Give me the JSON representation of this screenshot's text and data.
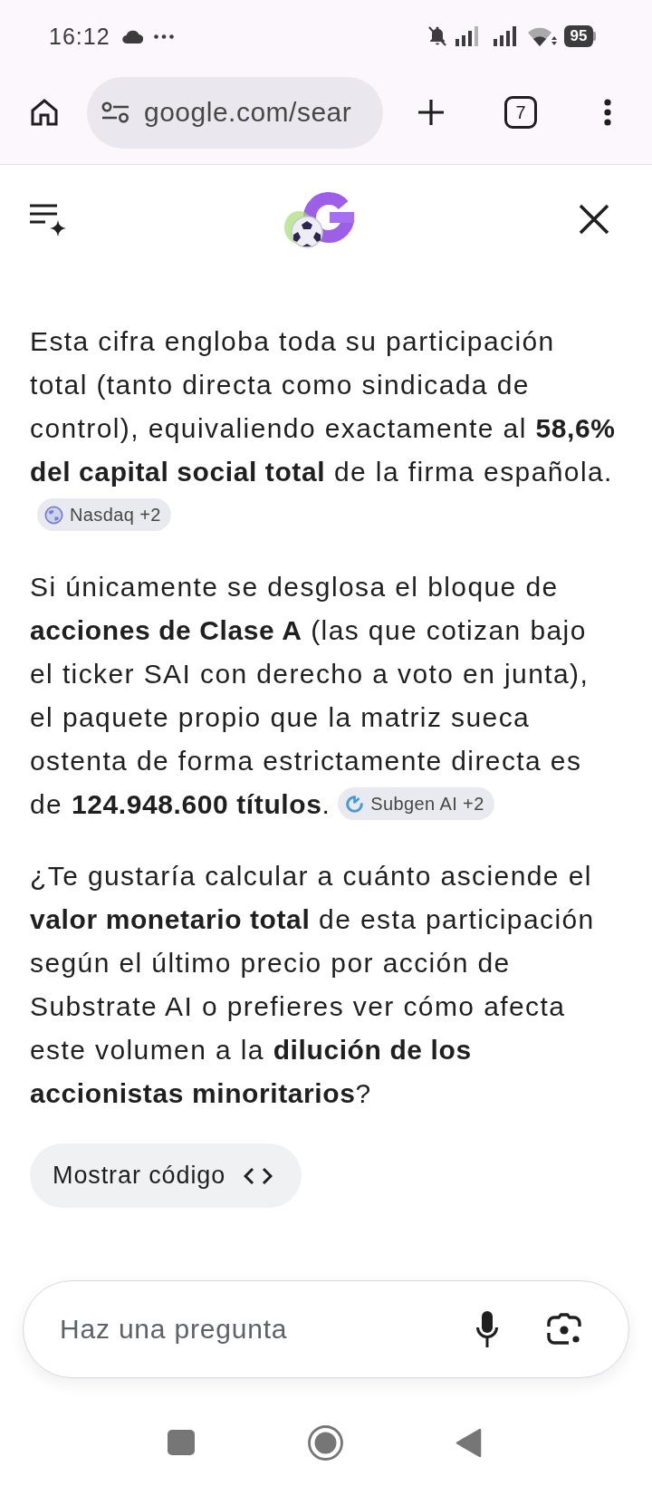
{
  "status_bar": {
    "time": "16:12",
    "battery": "95"
  },
  "browser_toolbar": {
    "url": "google.com/sear",
    "tab_count": "7"
  },
  "answer": {
    "paragraphs": [
      {
        "text": "Esta cifra engloba toda su participación total (tanto directa como sindicada de control), equivaliendo exactamente al **58,6% del capital social total** de la firma española.",
        "source_chip": {
          "kind": "globe",
          "label": "Nasdaq +2"
        }
      },
      {
        "text": "Si únicamente se desglosa el bloque de **acciones de Clase A** (las que cotizan bajo el ticker SAI con derecho a voto en junta), el paquete propio que la matriz sueca ostenta de forma estrictamente directa es de **124.948.600 títulos**.",
        "source_chip": {
          "kind": "ring",
          "label": "Subgen AI +2"
        }
      },
      {
        "text": "¿Te gustaría calcular a cuánto asciende el **valor monetario total** de esta participación según el último precio por acción de Substrate AI o prefieres ver cómo afecta este volumen a la **dilución de los accionistas minoritarios**?"
      }
    ]
  },
  "show_code_button": {
    "label": "Mostrar código"
  },
  "ask_field": {
    "placeholder": "Haz una pregunta"
  }
}
